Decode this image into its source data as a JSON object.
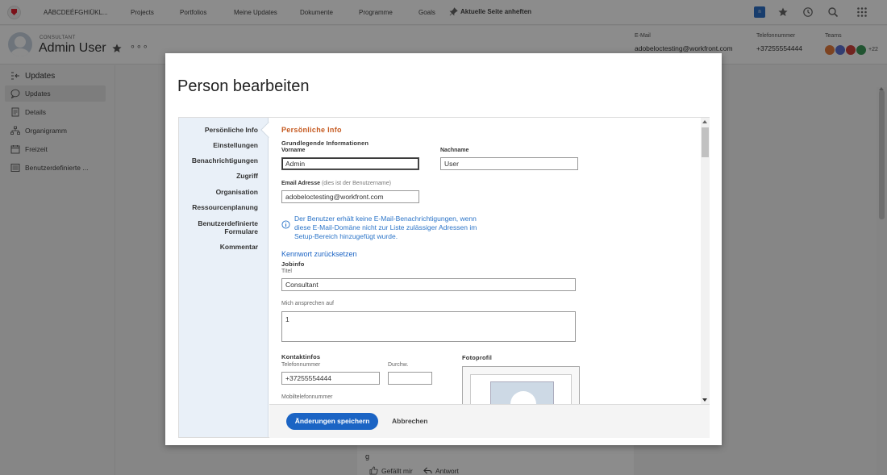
{
  "topnav": {
    "app_label": "AÄBCDEÉFGHIÜKL...",
    "items": [
      "Projects",
      "Portfolios",
      "Meine Updates",
      "Dokumente",
      "Programme",
      "Goals"
    ],
    "pin_label": "Aktuelle Seite anheften",
    "badge": "n",
    "icons": [
      "star-icon",
      "history-icon",
      "search-icon",
      "apps-grid-icon"
    ]
  },
  "user": {
    "role": "CONSULTANT",
    "name": "Admin User",
    "email_label": "E-Mail",
    "email": "adobeloctesting@workfront.com",
    "phone_label": "Telefonnummer",
    "phone": "+37255554444",
    "teams_label": "Teams",
    "teams_more": "+22",
    "team_colors": [
      "#e37b3c",
      "#5b6fcf",
      "#d0433b",
      "#3c9a5a",
      "#8a8a8a"
    ]
  },
  "sidebar": {
    "title": "Updates",
    "items": [
      {
        "label": "Updates",
        "icon": "chat-bubble-icon",
        "active": true
      },
      {
        "label": "Details",
        "icon": "document-icon",
        "active": false
      },
      {
        "label": "Organigramm",
        "icon": "org-chart-icon",
        "active": false
      },
      {
        "label": "Freizeit",
        "icon": "calendar-icon",
        "active": false
      },
      {
        "label": "Benutzerdefinierte ...",
        "icon": "custom-form-icon",
        "active": false
      }
    ]
  },
  "feed": {
    "text": "g",
    "like": "Gefällt mir",
    "reply": "Antwort"
  },
  "modal": {
    "title": "Person bearbeiten",
    "nav": [
      "Persönliche Info",
      "Einstellungen",
      "Benachrichtigungen",
      "Zugriff",
      "Organisation",
      "Ressourcenplanung",
      "Benutzerdefinierte Formulare",
      "Kommentar"
    ],
    "section_title": "Persönliche Info",
    "basic_info": "Grundlegende Informationen",
    "first_name_label": "Vorname",
    "first_name": "Admin",
    "last_name_label": "Nachname",
    "last_name": "User",
    "email_label": "Email Adresse",
    "email_hint": "(dies ist der Benutzername)",
    "email": "adobeloctesting@workfront.com",
    "info_line1": "Der Benutzer erhält keine E-Mail-Benachrichtigungen, wenn",
    "info_line2": "diese E-Mail-Domäne nicht zur Liste zulässiger Adressen im",
    "info_line3": "Setup-Bereich hinzugefügt wurde.",
    "reset_password": "Kennwort zurücksetzen",
    "jobinfo": "Jobinfo",
    "title_label": "Titel",
    "title_value": "Consultant",
    "address_label": "Mich ansprechen auf",
    "address_value": "1",
    "contact": "Kontaktinfos",
    "phone_label": "Telefonnummer",
    "phone": "+37255554444",
    "ext_label": "Durchw.",
    "ext": "",
    "mobile_label": "Mobiltelefonnummer",
    "photo_label": "Fotoprofil",
    "save": "Änderungen speichern",
    "cancel": "Abbrechen"
  }
}
